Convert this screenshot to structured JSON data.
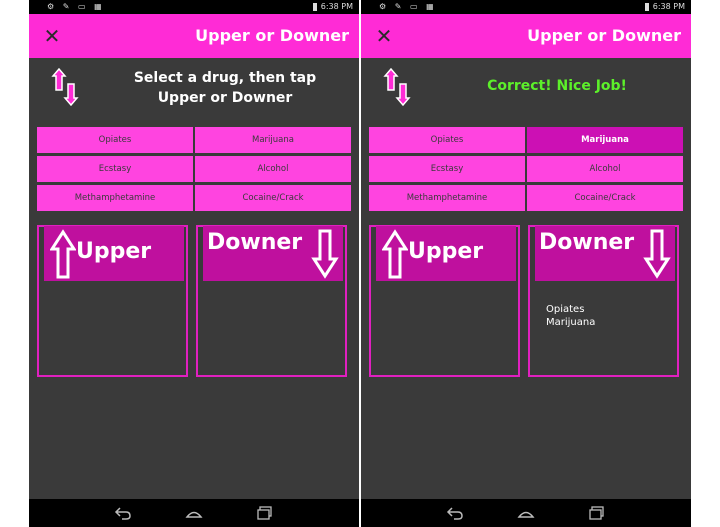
{
  "status": {
    "time": "6:38 PM",
    "icons": "⚙ ✎ ▭ ▦"
  },
  "app": {
    "title": "Upper or Downer"
  },
  "drugs": [
    "Opiates",
    "Marijuana",
    "Ecstasy",
    "Alcohol",
    "Methamphetamine",
    "Cocaine/Crack"
  ],
  "left_screen": {
    "prompt": "Select a drug, then tap Upper or Downer",
    "selected_drug": "",
    "upper_items": [],
    "downer_items": []
  },
  "right_screen": {
    "feedback": "Correct! Nice Job!",
    "selected_drug": "Marijuana",
    "upper_items": [],
    "downer_items": [
      "Opiates",
      "Marijuana"
    ]
  },
  "bins": {
    "upper_label": "Upper",
    "downer_label": "Downer"
  },
  "colors": {
    "accent": "#ff2bd6",
    "button": "#ff44e0",
    "button_selected": "#cc10b4",
    "bin_header": "#bf109e",
    "success": "#5cf02a",
    "background": "#3a3a3a"
  },
  "icons": {
    "close": "close-icon",
    "logo": "up-down-arrows-logo-icon",
    "back": "back-icon",
    "home": "home-icon",
    "recents": "recents-icon"
  }
}
